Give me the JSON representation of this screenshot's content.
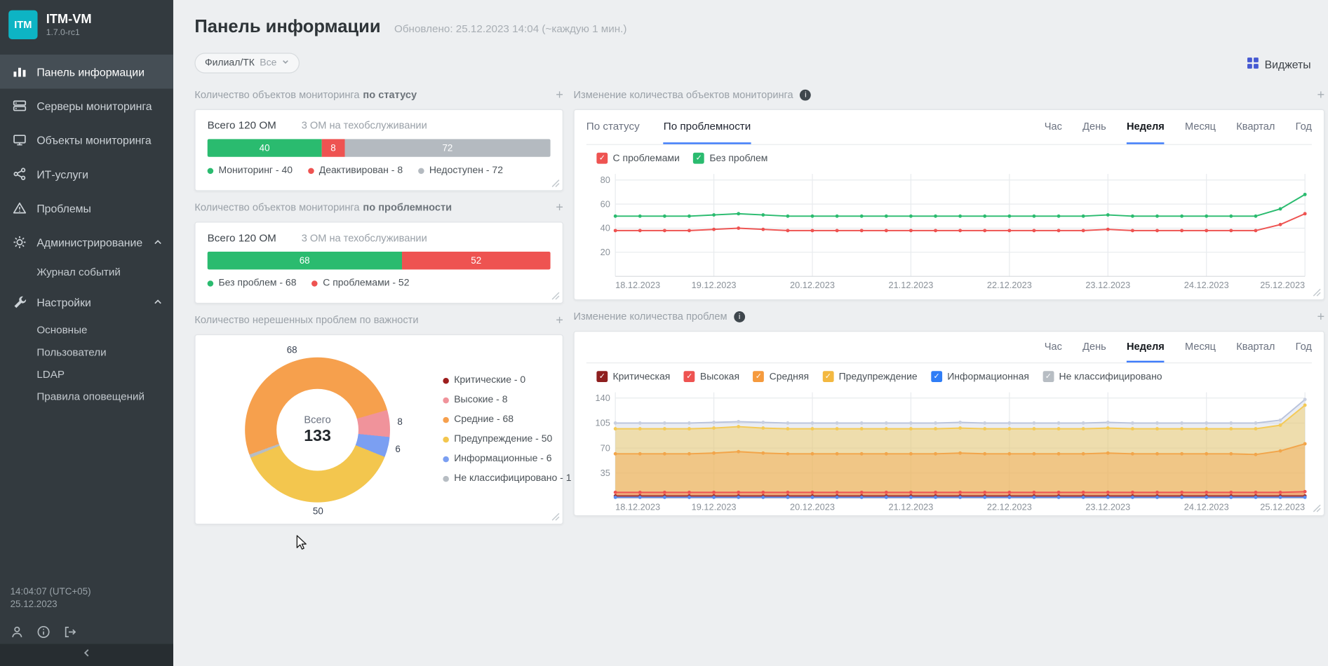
{
  "app": {
    "logo_text": "ITM",
    "name": "ITM-VM",
    "version": "1.7.0-rc1"
  },
  "sidebar": {
    "dashboard": "Панель информации",
    "servers": "Серверы мониторинга",
    "objects": "Объекты мониторинга",
    "it_services": "ИТ-услуги",
    "problems": "Проблемы",
    "administration": "Администрирование",
    "event_log": "Журнал событий",
    "settings": "Настройки",
    "settings_basic": "Основные",
    "settings_users": "Пользователи",
    "settings_ldap": "LDAP",
    "settings_rules": "Правила оповещений",
    "time": "14:04:07 (UTC+05)",
    "date": "25.12.2023"
  },
  "header": {
    "title": "Панель информации",
    "updated": "Обновлено: 25.12.2023 14:04 (~каждую 1 мин.)",
    "filter_label": "Филиал/ТК",
    "filter_value": "Все",
    "widgets_button": "Виджеты"
  },
  "widgets": {
    "status": {
      "title": "Количество объектов мониторинга",
      "title_bold": "по статусу",
      "total": "Всего 120 ОМ",
      "maintenance": "3 ОМ на техобслуживании",
      "segments": [
        {
          "label": "Мониторинг",
          "value": 40,
          "color": "#2abb6f"
        },
        {
          "label": "Деактивирован",
          "value": 8,
          "color": "#ee5351"
        },
        {
          "label": "Недоступен",
          "value": 72,
          "color": "#b4bac0"
        }
      ]
    },
    "problemness": {
      "title": "Количество объектов мониторинга",
      "title_bold": "по проблемности",
      "total": "Всего 120 ОМ",
      "maintenance": "3 ОМ на техобслуживании",
      "segments": [
        {
          "label": "Без проблем",
          "value": 68,
          "color": "#2abb6f"
        },
        {
          "label": "С проблемами",
          "value": 52,
          "color": "#ee5351"
        }
      ]
    },
    "severity_donut": {
      "title": "Количество нерешенных проблем по важности",
      "center_label": "Всего",
      "total": 133,
      "start_angle": 250,
      "ring_order": [
        2,
        1,
        4,
        3,
        5,
        0
      ],
      "slices": [
        {
          "label": "Критические",
          "value": 0,
          "color": "#9d1d1d"
        },
        {
          "label": "Высокие",
          "value": 8,
          "color": "#f0939b"
        },
        {
          "label": "Средние",
          "value": 68,
          "color": "#f6a04d"
        },
        {
          "label": "Предупреждение",
          "value": 50,
          "color": "#f3c64e"
        },
        {
          "label": "Информационные",
          "value": 6,
          "color": "#7b9ff2"
        },
        {
          "label": "Не классифицировано",
          "value": 1,
          "color": "#b7bdc3"
        }
      ]
    },
    "om_change": {
      "title": "Изменение количества объектов мониторинга",
      "tabs": [
        {
          "label": "По статусу",
          "active": false
        },
        {
          "label": "По проблемности",
          "active": true
        }
      ],
      "ranges": {
        "options": [
          "Час",
          "День",
          "Неделя",
          "Месяц",
          "Квартал",
          "Год"
        ],
        "active": "Неделя"
      },
      "legend": [
        {
          "label": "С проблемами",
          "color": "#ee5351"
        },
        {
          "label": "Без проблем",
          "color": "#2abb6f"
        }
      ],
      "chart": {
        "type": "line",
        "y_max": 85,
        "y_ticks": [
          20,
          40,
          60,
          80
        ],
        "x_labels": [
          "18.12.2023",
          "19.12.2023",
          "20.12.2023",
          "21.12.2023",
          "22.12.2023",
          "23.12.2023",
          "24.12.2023",
          "25.12.2023"
        ],
        "series": [
          {
            "name": "Без проблем",
            "color": "#2abb6f",
            "values": [
              50,
              50,
              50,
              50,
              51,
              52,
              51,
              50,
              50,
              50,
              50,
              50,
              50,
              50,
              50,
              50,
              50,
              50,
              50,
              50,
              51,
              50,
              50,
              50,
              50,
              50,
              50,
              56,
              68
            ]
          },
          {
            "name": "С проблемами",
            "color": "#ee5351",
            "values": [
              38,
              38,
              38,
              38,
              39,
              40,
              39,
              38,
              38,
              38,
              38,
              38,
              38,
              38,
              38,
              38,
              38,
              38,
              38,
              38,
              39,
              38,
              38,
              38,
              38,
              38,
              38,
              43,
              52
            ]
          }
        ]
      }
    },
    "problems_change": {
      "title": "Изменение количества проблем",
      "ranges": {
        "options": [
          "Час",
          "День",
          "Неделя",
          "Месяц",
          "Квартал",
          "Год"
        ],
        "active": "Неделя"
      },
      "legend": [
        {
          "label": "Критическая",
          "color": "#8e1f1f"
        },
        {
          "label": "Высокая",
          "color": "#ee5351"
        },
        {
          "label": "Средняя",
          "color": "#f59a3d"
        },
        {
          "label": "Предупреждение",
          "color": "#f3b840"
        },
        {
          "label": "Информационная",
          "color": "#2f7df6"
        },
        {
          "label": "Не классифицировано",
          "color": "#b7bdc3"
        }
      ],
      "chart": {
        "type": "area",
        "y_max": 148,
        "y_ticks": [
          35,
          70,
          105,
          140
        ],
        "x_labels": [
          "18.12.2023",
          "19.12.2023",
          "20.12.2023",
          "21.12.2023",
          "22.12.2023",
          "23.12.2023",
          "24.12.2023",
          "25.12.2023"
        ],
        "series": [
          {
            "name": "Не классифицировано",
            "color": "#b9c3dc",
            "dot": "#c8cfe0",
            "fill": "rgba(185,195,220,0.30)",
            "values": [
              105,
              105,
              105,
              105,
              106,
              107,
              106,
              105,
              105,
              105,
              105,
              105,
              105,
              105,
              106,
              105,
              105,
              105,
              105,
              105,
              106,
              105,
              105,
              105,
              105,
              105,
              105,
              109,
              138
            ]
          },
          {
            "name": "Предупреждение",
            "color": "#f4ca57",
            "fill": "rgba(244,202,87,0.45)",
            "values": [
              97,
              97,
              97,
              97,
              98,
              100,
              98,
              97,
              97,
              97,
              97,
              97,
              97,
              97,
              98,
              97,
              97,
              97,
              97,
              97,
              98,
              97,
              97,
              97,
              97,
              97,
              97,
              102,
              130
            ]
          },
          {
            "name": "Средняя",
            "color": "#f2a54a",
            "fill": "rgba(242,165,74,0.40)",
            "values": [
              62,
              62,
              62,
              62,
              63,
              65,
              63,
              62,
              62,
              62,
              62,
              62,
              62,
              62,
              63,
              62,
              62,
              62,
              62,
              62,
              63,
              62,
              62,
              62,
              62,
              62,
              61,
              66,
              76
            ]
          },
          {
            "name": "Высокая",
            "color": "#ee5351",
            "fill": "rgba(238,83,81,0.25)",
            "values": [
              8,
              8,
              8,
              8,
              8,
              8,
              8,
              8,
              8,
              8,
              8,
              8,
              8,
              8,
              8,
              8,
              8,
              8,
              8,
              8,
              8,
              8,
              8,
              8,
              8,
              8,
              8,
              8,
              9
            ]
          },
          {
            "name": "Критическая",
            "color": "#a03030",
            "fill": "none",
            "values": [
              3,
              3,
              3,
              3,
              3,
              3,
              3,
              3,
              3,
              3,
              3,
              3,
              3,
              3,
              3,
              3,
              3,
              3,
              3,
              3,
              3,
              3,
              3,
              3,
              3,
              3,
              3,
              3,
              3
            ]
          },
          {
            "name": "Информационная",
            "color": "#5b8def",
            "fill": "none",
            "values": [
              1,
              1,
              1,
              1,
              1,
              1,
              1,
              1,
              1,
              1,
              1,
              1,
              1,
              1,
              1,
              1,
              1,
              1,
              1,
              1,
              1,
              1,
              1,
              1,
              1,
              1,
              1,
              1,
              1
            ]
          }
        ]
      }
    }
  }
}
